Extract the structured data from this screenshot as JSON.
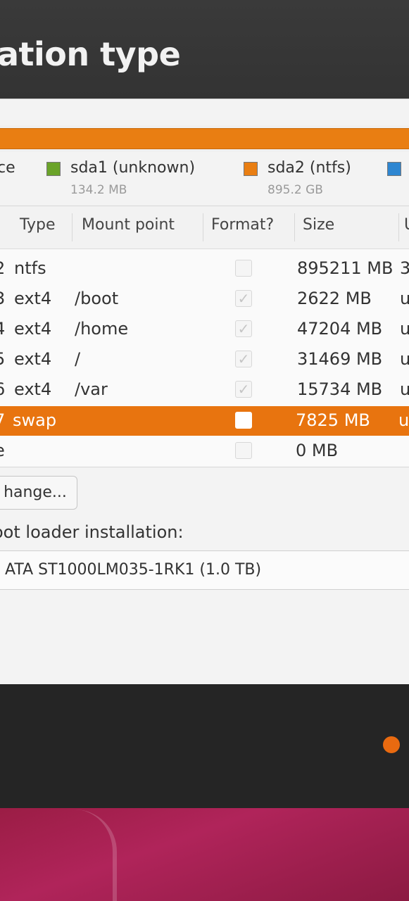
{
  "header": {
    "title": "ation type"
  },
  "legend": [
    {
      "name": "ce",
      "size": "",
      "color": ""
    },
    {
      "name": "sda1 (unknown)",
      "size": "134.2 MB",
      "color": "#6aa329"
    },
    {
      "name": "sda2 (ntfs)",
      "size": "895.2 GB",
      "color": "#e97e12"
    },
    {
      "name": "",
      "size": "",
      "color": "#2e86d1"
    }
  ],
  "table": {
    "columns": [
      "Type",
      "Mount point",
      "Format?",
      "Size",
      "U"
    ],
    "rows": [
      {
        "num": "2",
        "type": "ntfs",
        "mount": "",
        "format": "",
        "size": "895211 MB",
        "used": "3"
      },
      {
        "num": "3",
        "type": "ext4",
        "mount": "/boot",
        "format": "✓",
        "size": "2622 MB",
        "used": "u"
      },
      {
        "num": "4",
        "type": "ext4",
        "mount": "/home",
        "format": "✓",
        "size": "47204 MB",
        "used": "u"
      },
      {
        "num": "5",
        "type": "ext4",
        "mount": "/",
        "format": "✓",
        "size": "31469 MB",
        "used": "u"
      },
      {
        "num": "6",
        "type": "ext4",
        "mount": "/var",
        "format": "✓",
        "size": "15734 MB",
        "used": "u"
      },
      {
        "num": "7",
        "type": "swap",
        "mount": "",
        "format": "",
        "size": "7825 MB",
        "used": "u"
      },
      {
        "num": "e",
        "type": "",
        "mount": "",
        "format": "",
        "size": "0 MB",
        "used": ""
      }
    ]
  },
  "buttons": {
    "change": "hange..."
  },
  "bootloader": {
    "label": "oot loader installation:",
    "device": "ATA ST1000LM035-1RK1 (1.0 TB)"
  },
  "colors": {
    "accent": "#e8740f",
    "sda1": "#6aa329",
    "free": "#2e86d1"
  }
}
